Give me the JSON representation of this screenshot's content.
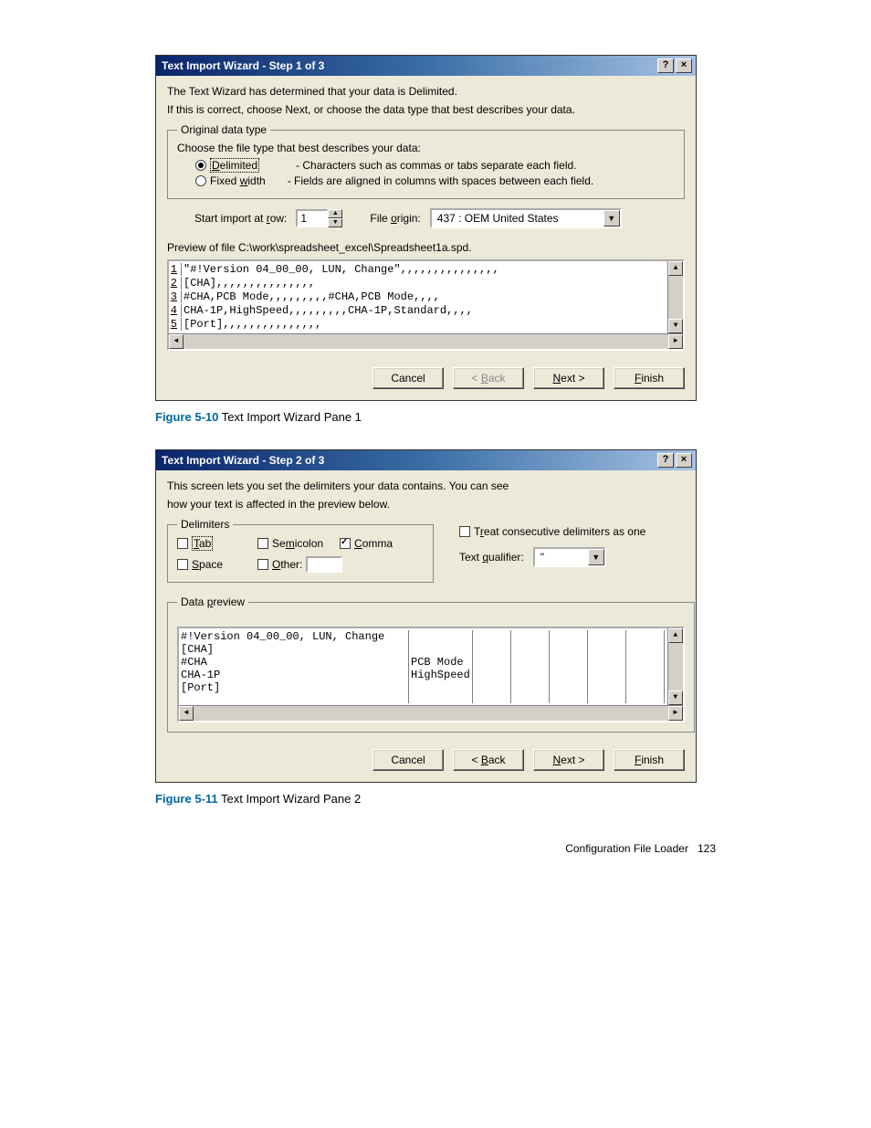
{
  "dialog1": {
    "title": "Text Import Wizard - Step 1 of 3",
    "intro1": "The Text Wizard has determined that your data is Delimited.",
    "intro2": "If this is correct, choose Next, or choose the data type that best describes your data.",
    "groupLegend": "Original data type",
    "choosePrompt": "Choose the file type that best describes your data:",
    "delimitedLabel": "Delimited",
    "delimitedDesc": "- Characters such as commas or tabs separate each field.",
    "fixedLabel": "Fixed width",
    "fixedDesc": "- Fields are aligned in columns with spaces between each field.",
    "startRowLabel": "Start import at row:",
    "startRowValue": "1",
    "fileOriginLabel": "File origin:",
    "fileOriginValue": "437 : OEM United States",
    "previewLabel": "Preview of file C:\\work\\spreadsheet_excel\\Spreadsheet1a.spd.",
    "lines": [
      {
        "n": "1",
        "t": "\"#!Version 04_00_00, LUN, Change\",,,,,,,,,,,,,,,"
      },
      {
        "n": "2",
        "t": "[CHA],,,,,,,,,,,,,,,"
      },
      {
        "n": "3",
        "t": "#CHA,PCB Mode,,,,,,,,,#CHA,PCB Mode,,,,"
      },
      {
        "n": "4",
        "t": "CHA-1P,HighSpeed,,,,,,,,,CHA-1P,Standard,,,,"
      },
      {
        "n": "5",
        "t": "[Port],,,,,,,,,,,,,,,"
      }
    ],
    "btnCancel": "Cancel",
    "btnBack": "< Back",
    "btnNext": "Next >",
    "btnFinish": "Finish"
  },
  "caption1": {
    "num": "Figure 5-10",
    "txt": " Text Import Wizard Pane 1"
  },
  "dialog2": {
    "title": "Text Import Wizard - Step 2 of 3",
    "intro1": "This screen lets you set the delimiters your data contains.  You can see",
    "intro2": "how your text is affected in the preview below.",
    "delimLegend": "Delimiters",
    "tab": "Tab",
    "semicolon": "Semicolon",
    "comma": "Comma",
    "space": "Space",
    "other": "Other:",
    "treatConsec": "Treat consecutive delimiters as one",
    "textQualLabel": "Text qualifier:",
    "textQualValue": "\"",
    "dataPreviewLegend": "Data preview",
    "col1": [
      "#!Version 04_00_00, LUN, Change",
      "[CHA]",
      "#CHA",
      "CHA-1P",
      "[Port]"
    ],
    "col2": [
      "",
      "",
      "PCB Mode",
      "HighSpeed",
      ""
    ],
    "btnCancel": "Cancel",
    "btnBack": "< Back",
    "btnNext": "Next >",
    "btnFinish": "Finish"
  },
  "caption2": {
    "num": "Figure 5-11",
    "txt": " Text Import Wizard Pane 2"
  },
  "footer": {
    "label": "Configuration File Loader",
    "page": "123"
  }
}
